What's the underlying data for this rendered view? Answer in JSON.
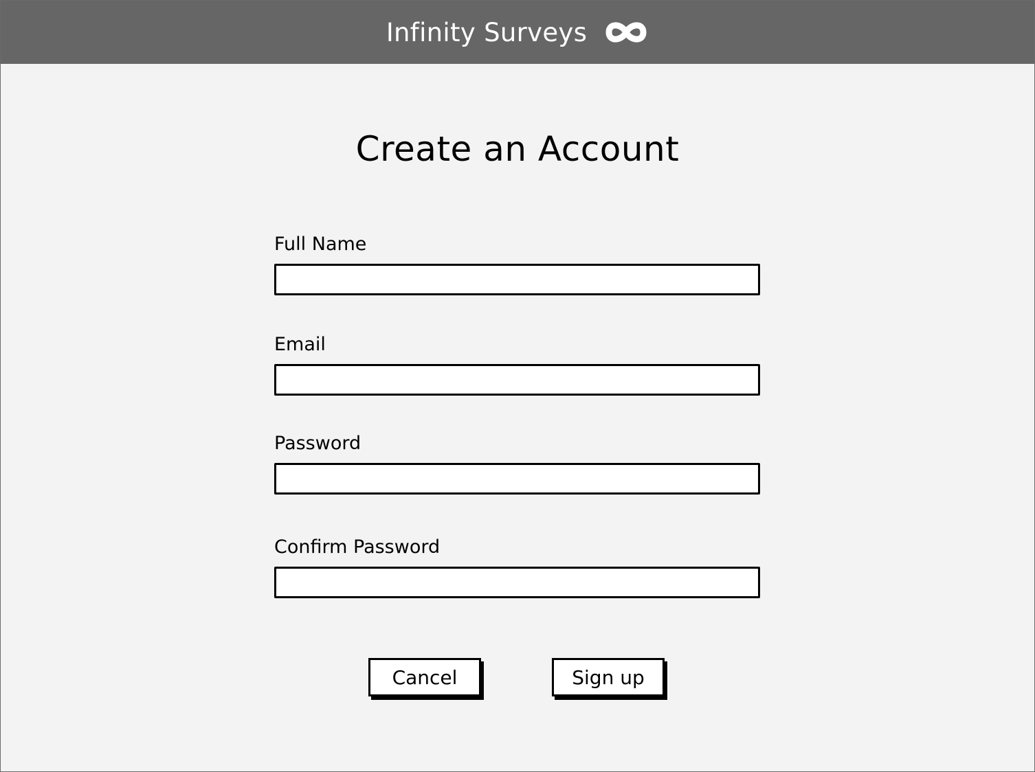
{
  "header": {
    "brand": "Infinity Surveys",
    "brand_icon": "infinity-icon",
    "background": "#666666"
  },
  "form": {
    "title": "Create an Account",
    "fields": [
      {
        "label": "Full Name",
        "value": "",
        "placeholder": ""
      },
      {
        "label": "Email",
        "value": "",
        "placeholder": ""
      },
      {
        "label": "Password",
        "value": "",
        "placeholder": ""
      },
      {
        "label": "Confirm Password",
        "value": "",
        "placeholder": ""
      }
    ],
    "cancel_label": "Cancel",
    "signup_label": "Sign up"
  }
}
